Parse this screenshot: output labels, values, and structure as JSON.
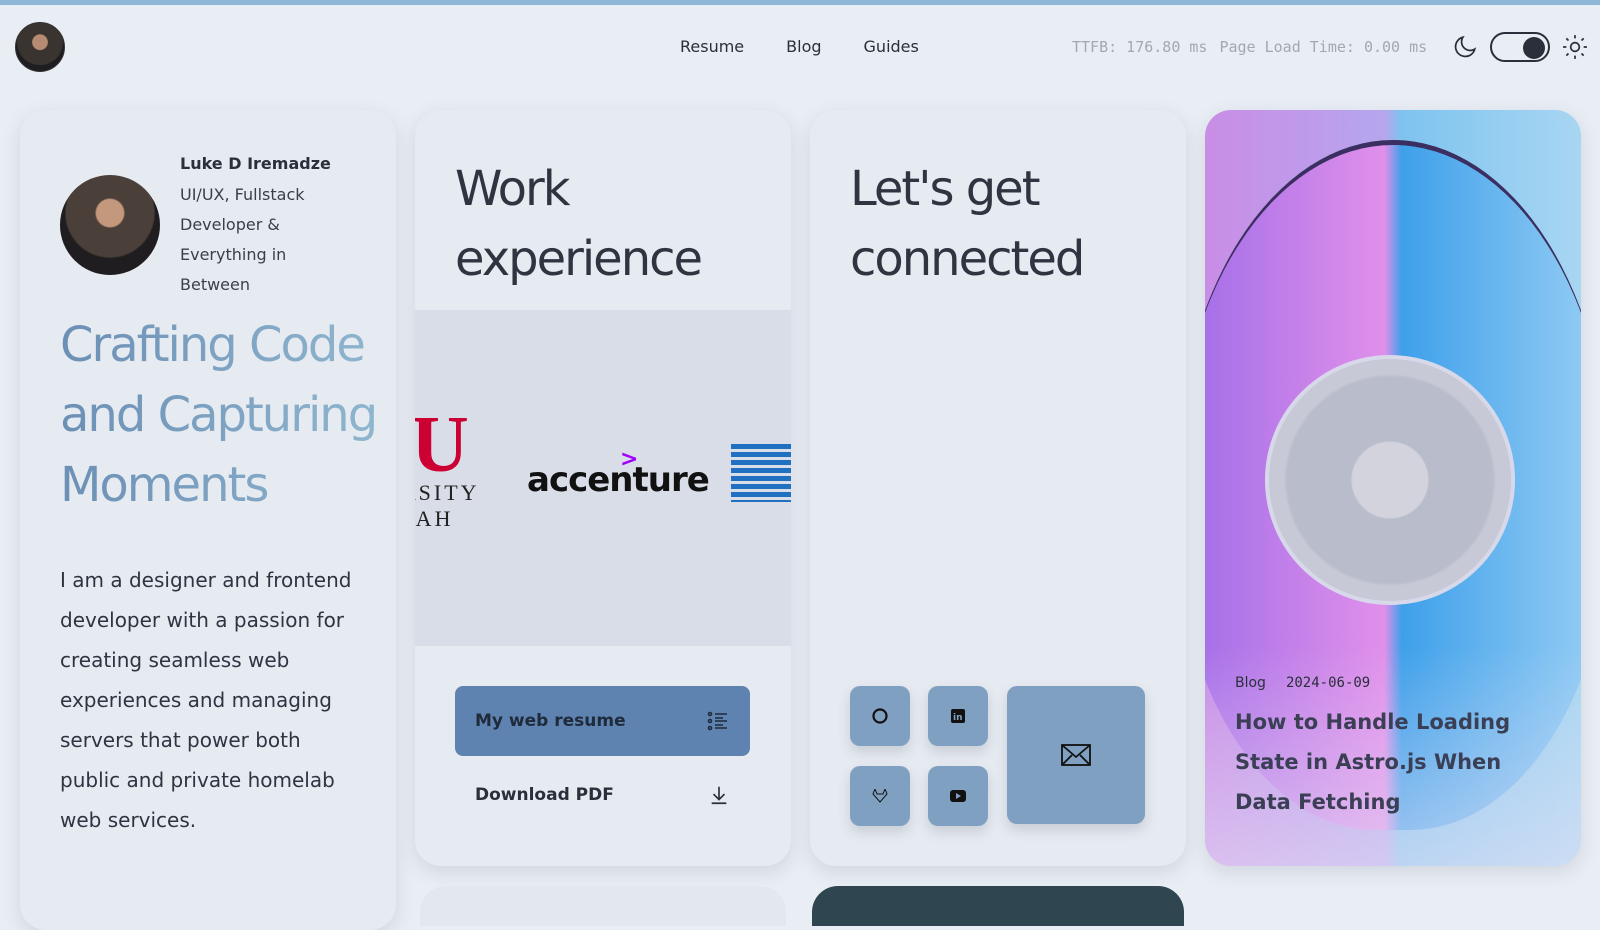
{
  "nav": {
    "items": [
      "Resume",
      "Blog",
      "Guides"
    ]
  },
  "metrics": {
    "ttfb": "TTFB: 176.80 ms",
    "page_load": "Page Load Time: 0.00 ms"
  },
  "theme": {
    "mode": "dark",
    "icons": [
      "moon-icon",
      "sun-icon"
    ]
  },
  "profile": {
    "name": "Luke D Iremadze",
    "role": "UI/UX, Fullstack Developer & Everything in Between",
    "headline": "Crafting Code and Capturing Moments",
    "bio": "I am a designer and frontend developer with a passion for creating seamless web experiences and managing servers that power both public and private homelab web services."
  },
  "work": {
    "title": "Work experience",
    "logos": {
      "utah_top": "U",
      "utah_bottom": "RSITY\nTAH",
      "accenture": "accenture",
      "accenture_mark": ">",
      "ibm": "IBM"
    },
    "resume_button": "My web resume",
    "pdf_button": "Download PDF"
  },
  "connect": {
    "title": "Let's get connected",
    "links": [
      "github",
      "linkedin",
      "gitlab",
      "youtube",
      "email"
    ]
  },
  "blog": {
    "category": "Blog",
    "date": "2024-06-09",
    "title": "How to Handle Loading State in Astro.js When Data Fetching"
  },
  "colors": {
    "accent": "#5f83b0",
    "social": "#80a0c2",
    "topbar": "#8fb8d6"
  }
}
